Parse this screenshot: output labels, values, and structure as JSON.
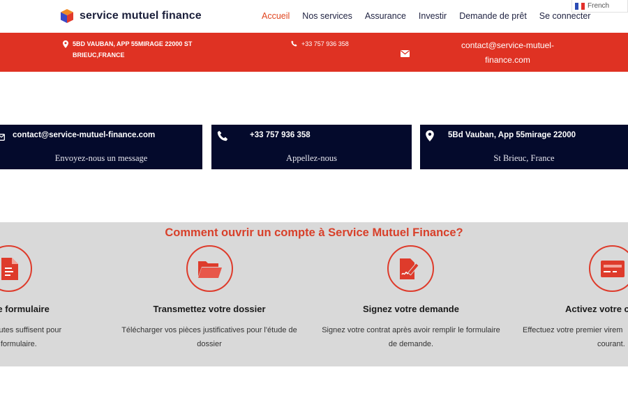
{
  "header": {
    "brand": "service mutuel finance",
    "nav": [
      {
        "label": "Accueil",
        "active": true
      },
      {
        "label": "Nos services",
        "active": false
      },
      {
        "label": "Assurance",
        "active": false
      },
      {
        "label": "Investir",
        "active": false
      },
      {
        "label": "Demande de prêt",
        "active": false
      },
      {
        "label": "Se connecter",
        "active": false
      }
    ],
    "language": "French"
  },
  "topbar": {
    "address_line1": "5BD VAUBAN, APP 55MIRAGE 22000 ST",
    "address_line2": "BRIEUC,FRANCE",
    "phone": "+33 757 936 358",
    "email_line1": "contact@service-mutuel-",
    "email_line2": "finance.com"
  },
  "cards": [
    {
      "icon": "envelope-icon",
      "title": "contact@service-mutuel-finance.com",
      "subtitle": "Envoyez-nous un message"
    },
    {
      "icon": "phone-icon",
      "title": "+33 757 936 358",
      "subtitle": "Appellez-nous"
    },
    {
      "icon": "map-pin-icon",
      "title": "5Bd Vauban, App 55mirage 22000",
      "subtitle": "St Brieuc, France"
    }
  ],
  "steps_section": {
    "title": "Comment ouvrir un compte à Service Mutuel Finance?",
    "steps": [
      {
        "icon": "document-icon",
        "title": "notre formulaire",
        "desc_line1": "ques minutes suffisent pour",
        "desc_line2": "le formulaire."
      },
      {
        "icon": "folder-open-icon",
        "title": "Transmettez votre dossier",
        "desc_line1": "Télécharger vos pièces justificatives pour l'étude de",
        "desc_line2": "dossier"
      },
      {
        "icon": "signature-icon",
        "title": "Signez votre demande",
        "desc_line1": "Signez votre contrat après avoir remplir le formulaire",
        "desc_line2": "de demande."
      },
      {
        "icon": "credit-card-icon",
        "title": "Activez votre c",
        "desc_line1": "Effectuez votre premier virem",
        "desc_line2": "courant."
      }
    ]
  },
  "colors": {
    "accent_red": "#df3223",
    "navy": "#040a2c",
    "section_grey": "#d9d9d9",
    "nav_active": "#e0451f"
  }
}
